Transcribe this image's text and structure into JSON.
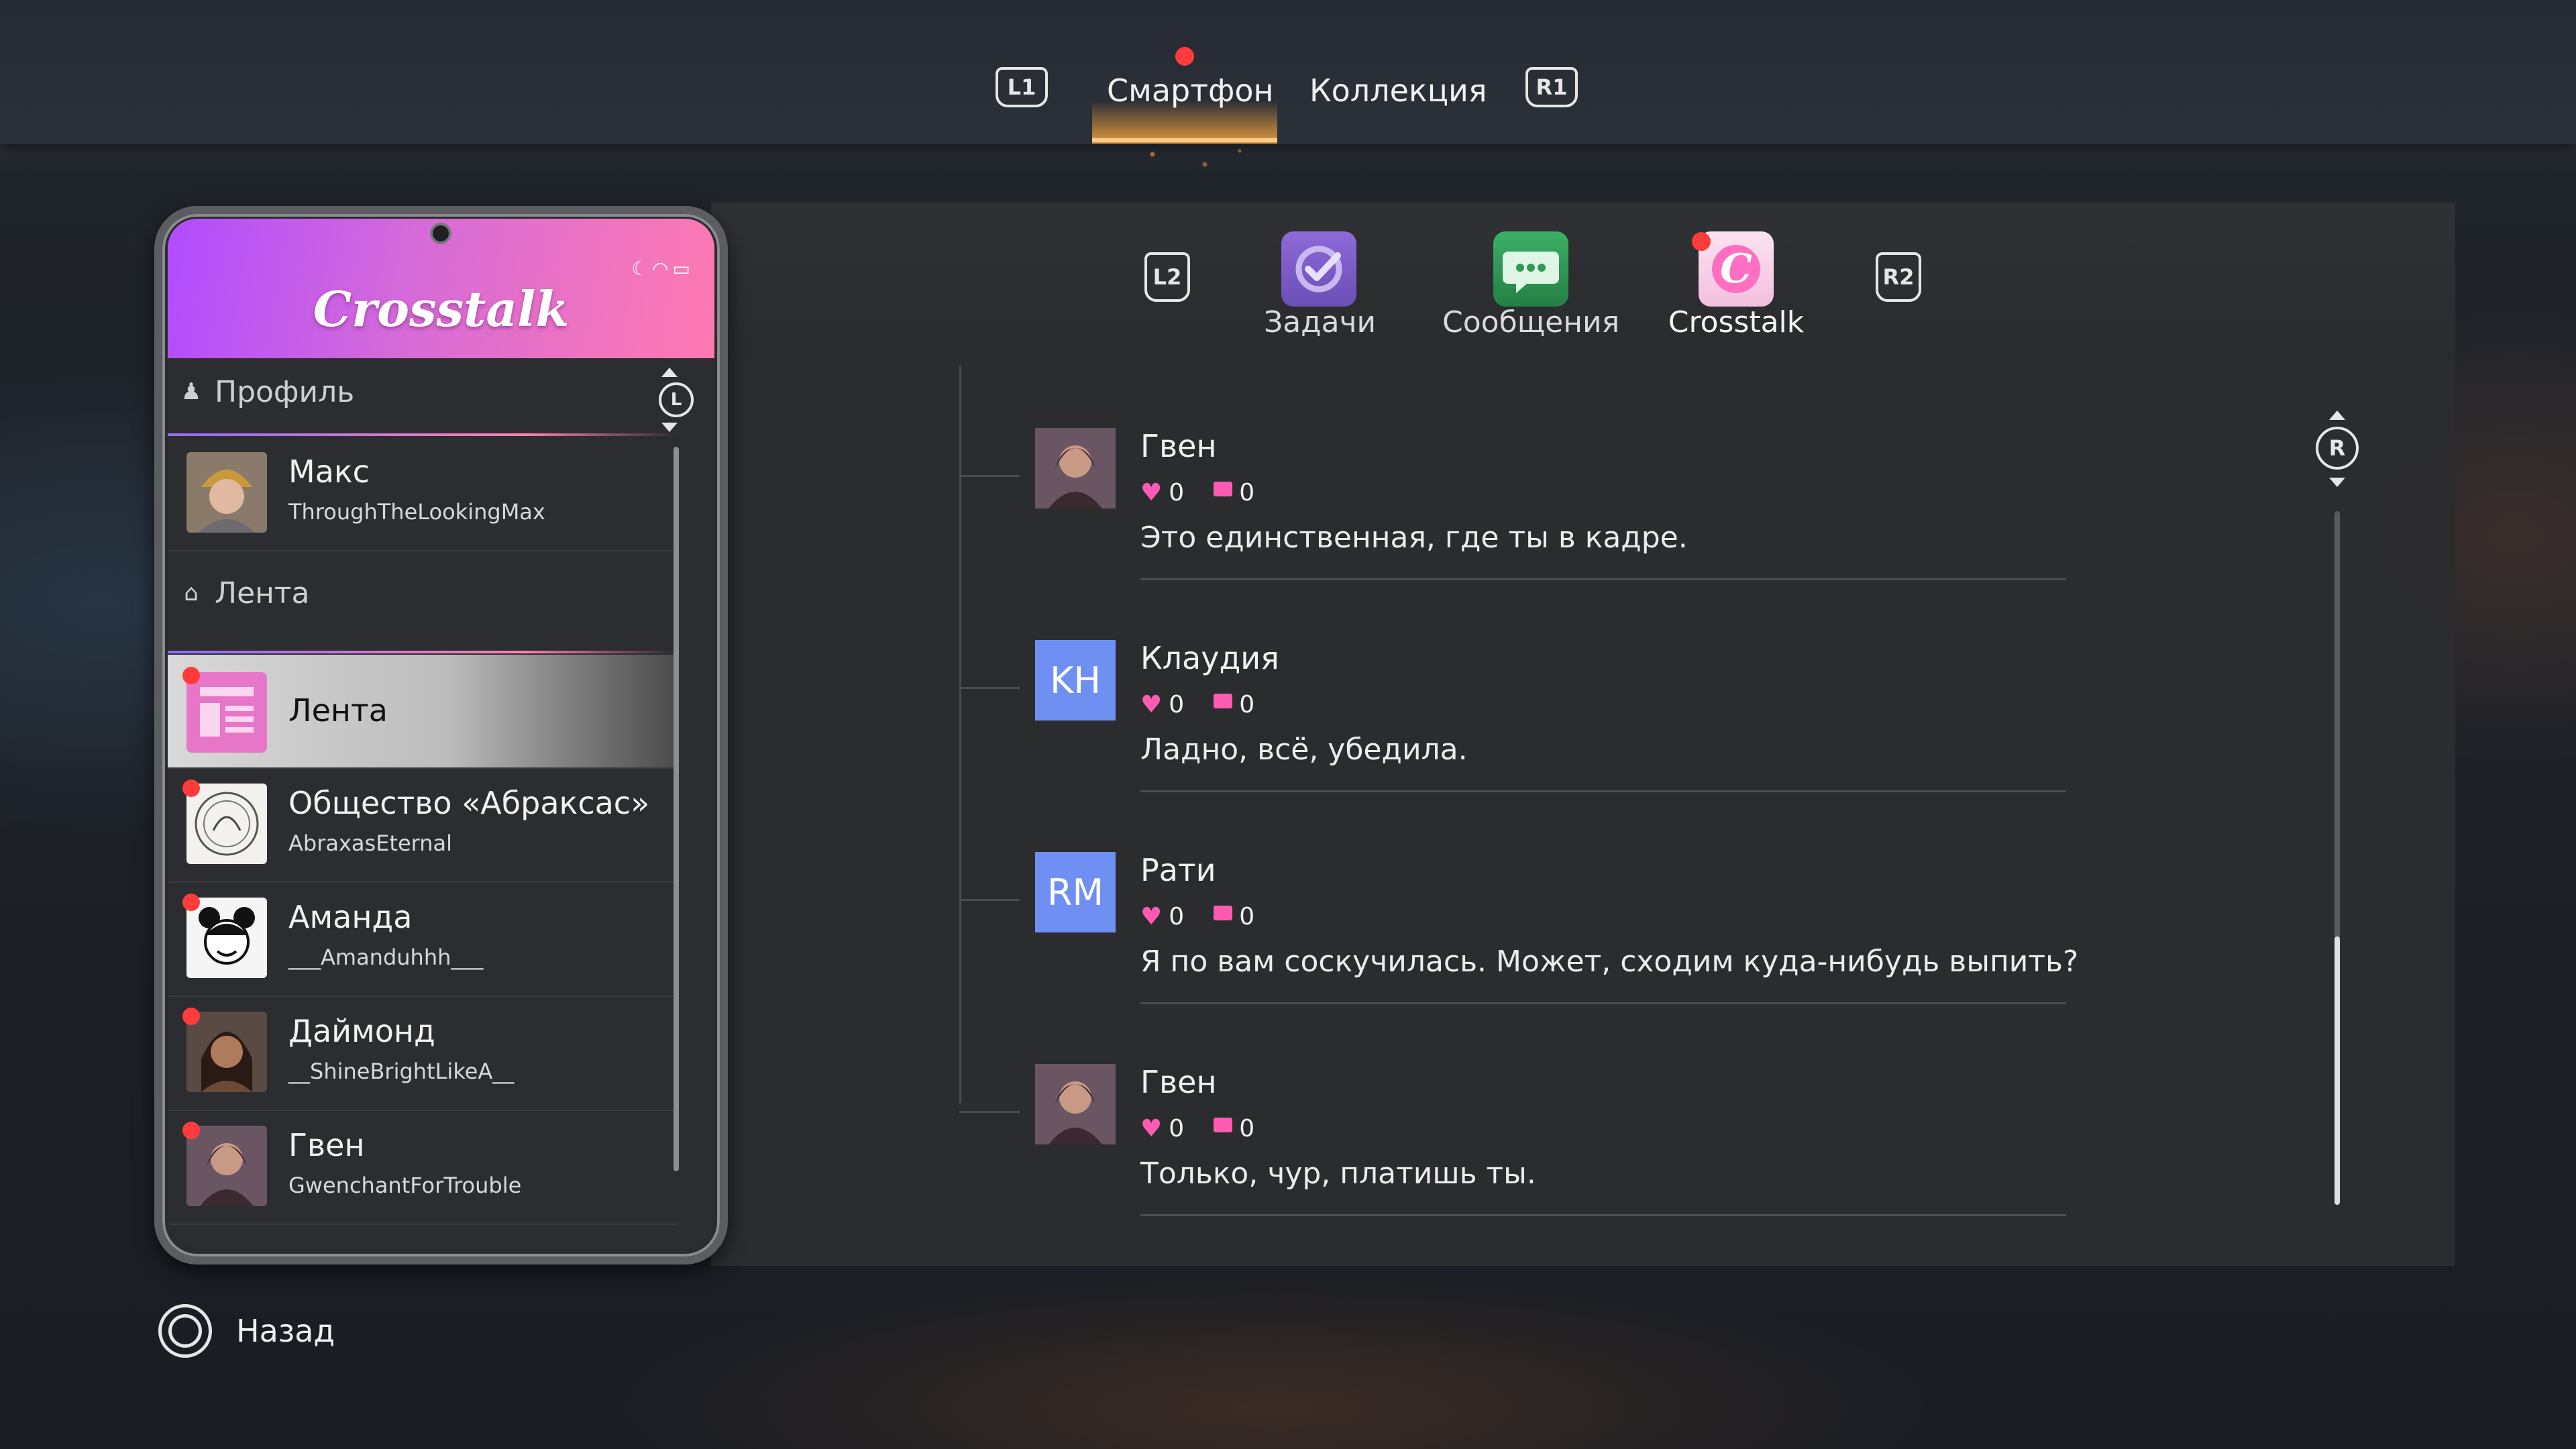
{
  "top_nav": {
    "left_hint": "L1",
    "right_hint": "R1",
    "tabs": [
      {
        "label": "Смартфон",
        "active": true
      },
      {
        "label": "Коллекция",
        "active": false
      }
    ]
  },
  "apps": {
    "left_hint": "L2",
    "right_hint": "R2",
    "items": [
      {
        "label": "Задачи",
        "icon": "tasks-check-icon",
        "color": "#7a5fc7"
      },
      {
        "label": "Сообщения",
        "icon": "chat-bubble-icon",
        "color": "#2f9a55"
      },
      {
        "label": "Crosstalk",
        "icon": "crosstalk-icon",
        "color": "#f4a6d6",
        "active": true
      }
    ]
  },
  "phone": {
    "app_title": "Crosstalk",
    "stick_hint": "L",
    "profile_section": "Профиль",
    "profile": {
      "name": "Макс",
      "handle": "ThroughTheLookingMax"
    },
    "feed_section": "Лента",
    "feeds": [
      {
        "name": "Лента",
        "handle": "",
        "selected": true,
        "unread": true
      },
      {
        "name": "Общество «Абраксас»",
        "handle": "AbraxasEternal",
        "unread": true
      },
      {
        "name": "Аманда",
        "handle": "___Amanduhhh___",
        "unread": true
      },
      {
        "name": "Даймонд",
        "handle": "__ShineBrightLikeA__",
        "unread": true
      },
      {
        "name": "Гвен",
        "handle": "GwenchantForTrouble",
        "unread": true
      }
    ]
  },
  "feed_view": {
    "stick_hint": "R",
    "posts": [
      {
        "author": "Гвен",
        "initials": "",
        "likes": "0",
        "comments": "0",
        "text": "Это единственная, где ты в кадре."
      },
      {
        "author": "Клаудия",
        "initials": "KH",
        "likes": "0",
        "comments": "0",
        "text": "Ладно, всё, убедила."
      },
      {
        "author": "Рати",
        "initials": "RM",
        "likes": "0",
        "comments": "0",
        "text": "Я по вам соскучилась. Может, сходим куда-нибудь выпить?"
      },
      {
        "author": "Гвен",
        "initials": "",
        "likes": "0",
        "comments": "0",
        "text": "Только, чур, платишь ты."
      }
    ]
  },
  "footer": {
    "back_label": "Назад"
  }
}
